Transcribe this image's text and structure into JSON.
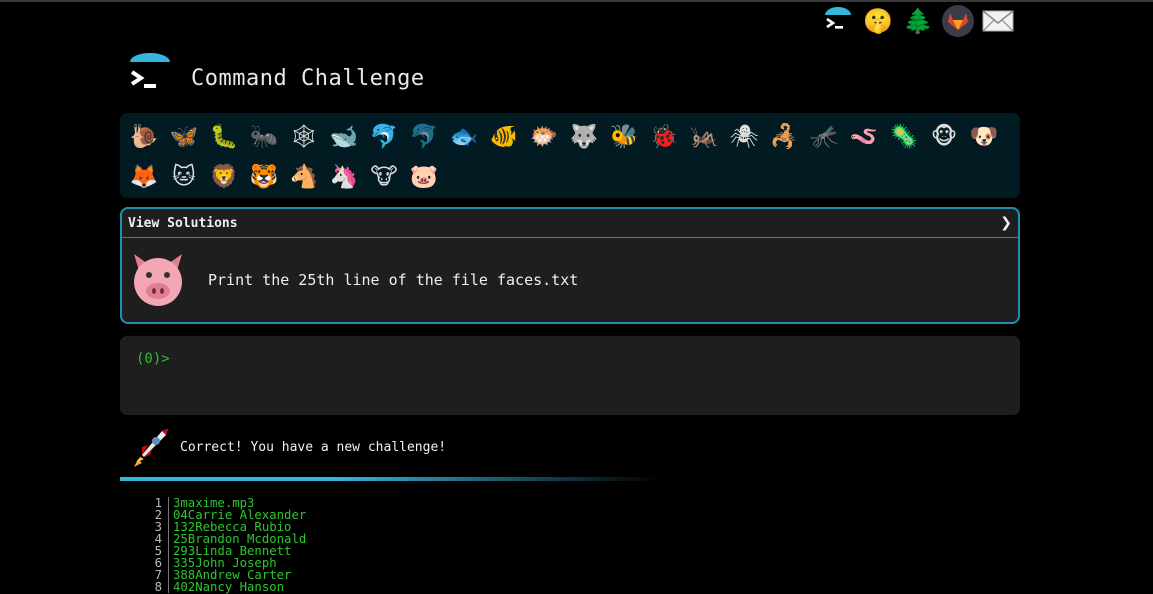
{
  "header": {
    "title": "Command Challenge",
    "top_icons": [
      "terminal-icon",
      "shushing-face-icon",
      "tree-icon",
      "gitlab-icon",
      "mail-icon"
    ]
  },
  "emoji_bar": {
    "items": [
      "🐌",
      "🦋",
      "🐛",
      "🐜",
      "🕸",
      "🐋",
      "🐬",
      "🐬",
      "🐟",
      "🐠",
      "🐡",
      "🐺",
      "🐝",
      "🐞",
      "🦗",
      "🕷",
      "🦂",
      "🦟",
      "🪱",
      "🦠",
      "🐵",
      "🐶",
      "🦊",
      "🐱",
      "🦁",
      "🐯",
      "🐴",
      "🦄",
      "🐮",
      "🐷"
    ],
    "names": [
      "snail",
      "butterfly",
      "caterpillar",
      "ant",
      "web",
      "whale",
      "dolphin",
      "dolphin-grey",
      "fish",
      "tropical-fish",
      "blowfish",
      "wolf",
      "bee",
      "ladybug",
      "cricket",
      "spider",
      "scorpion",
      "mosquito",
      "worm",
      "microbe",
      "monkey",
      "dog",
      "fox",
      "cat",
      "lion",
      "tiger",
      "horse",
      "unicorn",
      "cow",
      "pig"
    ]
  },
  "challenge": {
    "view_solutions": "View Solutions",
    "chevron": "❯",
    "text": "Print the 25th line of the file faces.txt"
  },
  "terminal": {
    "prompt": "(0)>"
  },
  "message": {
    "text": "Correct! You have a new challenge!"
  },
  "colors": {
    "accent": "#1f8fb0",
    "terminal_green": "#2fc62f",
    "emoji_bar_bg": "#021a22",
    "panel_bg": "#1e1e1e"
  },
  "file_lines": [
    {
      "n": "1",
      "text": "3maxime.mp3"
    },
    {
      "n": "2",
      "text": "04Carrie Alexander"
    },
    {
      "n": "3",
      "text": "132Rebecca Rubio"
    },
    {
      "n": "4",
      "text": "25Brandon Mcdonald"
    },
    {
      "n": "5",
      "text": "293Linda Bennett"
    },
    {
      "n": "6",
      "text": "335John Joseph"
    },
    {
      "n": "7",
      "text": "388Andrew Carter"
    },
    {
      "n": "8",
      "text": "402Nancy Hanson"
    }
  ]
}
